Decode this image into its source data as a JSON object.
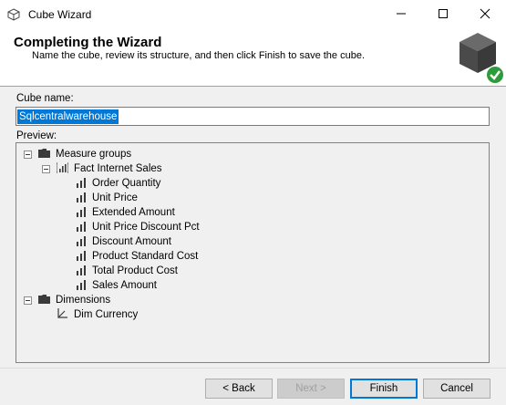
{
  "window": {
    "title": "Cube Wizard",
    "minimize_icon": "minimize-icon",
    "maximize_icon": "maximize-icon",
    "close_icon": "close-icon"
  },
  "header": {
    "title": "Completing the Wizard",
    "subtitle": "Name the cube, review its structure, and then click Finish to save the cube."
  },
  "form": {
    "cube_name_label": "Cube name:",
    "cube_name_value": "Sqlcentralwarehouse",
    "preview_label": "Preview:"
  },
  "tree": {
    "measure_groups": {
      "label": "Measure groups",
      "fact": {
        "label": "Fact Internet Sales",
        "measures": [
          "Order Quantity",
          "Unit Price",
          "Extended Amount",
          "Unit Price Discount Pct",
          "Discount Amount",
          "Product Standard Cost",
          "Total Product Cost",
          "Sales Amount"
        ]
      }
    },
    "dimensions": {
      "label": "Dimensions",
      "items": [
        "Dim Currency"
      ]
    }
  },
  "buttons": {
    "back": "< Back",
    "next": "Next >",
    "finish": "Finish",
    "cancel": "Cancel"
  },
  "colors": {
    "selection": "#0078d7",
    "checkmark": "#2e9b3a"
  }
}
